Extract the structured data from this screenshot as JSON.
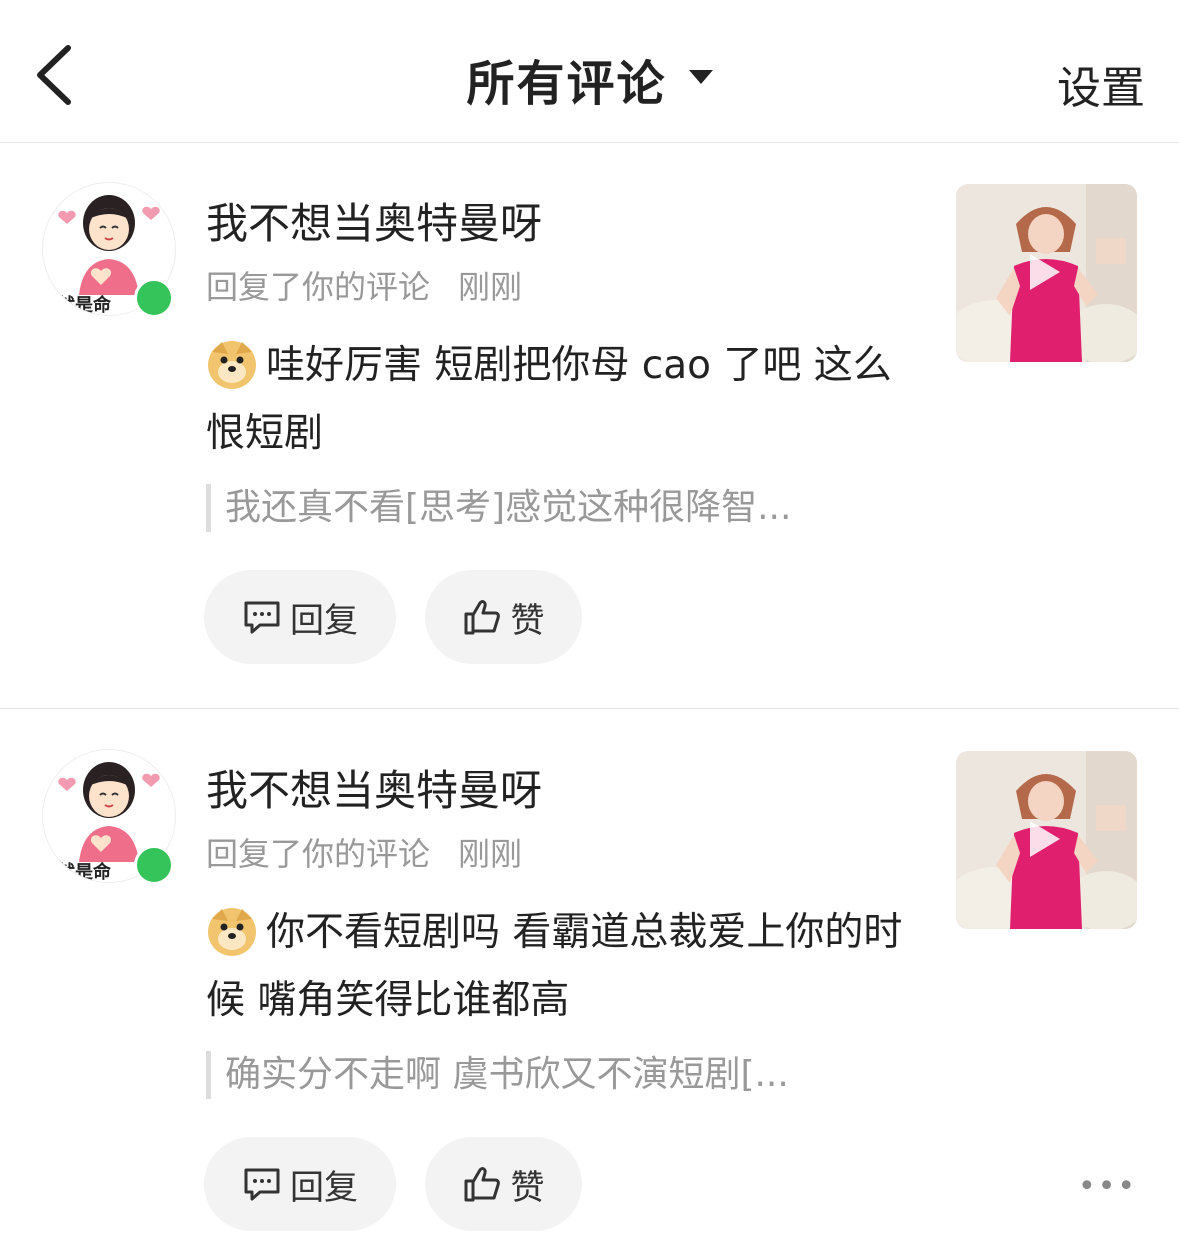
{
  "header": {
    "title": "所有评论",
    "settings_label": "设置"
  },
  "comments": [
    {
      "username": "我不想当奥特曼呀",
      "action": "回复了你的评论",
      "time": "刚刚",
      "text": "哇好厉害 短剧把你母 cao 了吧 这么恨短剧",
      "quote": "我还真不看[思考]感觉这种很降智...",
      "avatar_caption": "就是命"
    },
    {
      "username": "我不想当奥特曼呀",
      "action": "回复了你的评论",
      "time": "刚刚",
      "text": "你不看短剧吗 看霸道总裁爱上你的时候 嘴角笑得比谁都高",
      "quote": "确实分不走啊 虞书欣又不演短剧[...",
      "avatar_caption": "就是命"
    }
  ],
  "actions": {
    "reply_label": "回复",
    "like_label": "赞",
    "more_label": "•••"
  },
  "colors": {
    "online": "#35c45a",
    "button_bg": "#f3f3f3",
    "meta_text": "#999999"
  }
}
